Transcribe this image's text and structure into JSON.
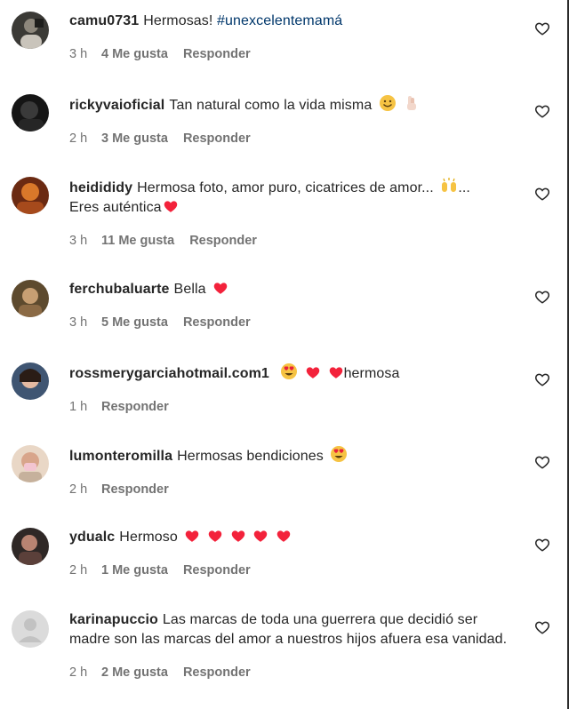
{
  "comments": [
    {
      "username": "camu0731",
      "text": "Hermosas!",
      "hashtag": "#unexcelentemamá",
      "time": "3 h",
      "likes": "4 Me gusta",
      "reply": "Responder",
      "emojis": []
    },
    {
      "username": "rickyvaioficial",
      "text": "Tan natural como la vida misma",
      "time": "2 h",
      "likes": "3 Me gusta",
      "reply": "Responder",
      "emojis": [
        "smiling-face-icon",
        "fingers-crossed-icon"
      ]
    },
    {
      "username": "heidididy",
      "text": "Hermosa foto, amor puro, cicatrices de amor...",
      "text2": "...",
      "text3": "Eres auténtica",
      "time": "3 h",
      "likes": "11 Me gusta",
      "reply": "Responder",
      "emojis": [
        "raising-hands-icon",
        "red-heart-icon"
      ]
    },
    {
      "username": "ferchubaluarte",
      "text": "Bella",
      "time": "3 h",
      "likes": "5 Me gusta",
      "reply": "Responder",
      "emojis": [
        "red-heart-icon"
      ]
    },
    {
      "username": "rossmerygarciahotmail.com1",
      "text": "hermosa",
      "time": "1 h",
      "likes": "",
      "reply": "Responder",
      "emojis": [
        "heart-eyes-icon",
        "red-heart-icon",
        "red-heart-icon"
      ]
    },
    {
      "username": "lumonteromilla",
      "text": "Hermosas bendiciones",
      "time": "2 h",
      "likes": "",
      "reply": "Responder",
      "emojis": [
        "heart-eyes-icon"
      ]
    },
    {
      "username": "ydualc",
      "text": "Hermoso",
      "time": "2 h",
      "likes": "1 Me gusta",
      "reply": "Responder",
      "emojis": [
        "red-heart-icon",
        "red-heart-icon",
        "red-heart-icon",
        "red-heart-icon",
        "red-heart-icon"
      ]
    },
    {
      "username": "karinapuccio",
      "text": "Las marcas de toda una guerrera que decidió ser madre son las marcas del amor a nuestros hijos afuera esa vanidad.",
      "time": "2 h",
      "likes": "2 Me gusta",
      "reply": "Responder",
      "emojis": []
    }
  ],
  "colors": {
    "text": "#262626",
    "meta": "#737373",
    "hashtag": "#00376b",
    "heart_emoji": "#f3223b"
  }
}
